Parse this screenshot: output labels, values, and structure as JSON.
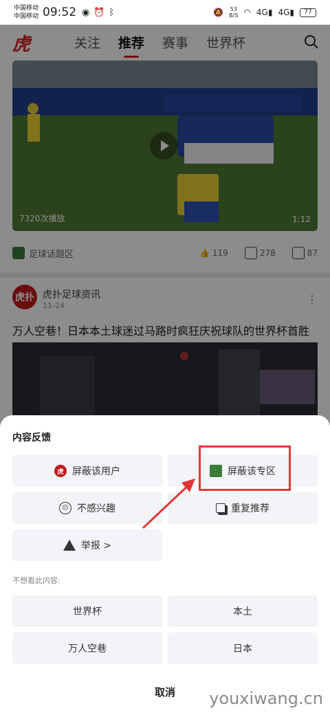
{
  "status": {
    "carriers": [
      "中国移动",
      "中国移动"
    ],
    "time": "09:52",
    "net_speed": "53\nB/S",
    "signal_labels": [
      "4G",
      "4G"
    ],
    "battery": "77"
  },
  "header": {
    "logo": "虎扑",
    "tabs": [
      {
        "label": "关注",
        "active": false
      },
      {
        "label": "推荐",
        "active": true
      },
      {
        "label": "赛事",
        "active": false
      },
      {
        "label": "世界杯",
        "active": false
      }
    ],
    "search_icon": "search-icon"
  },
  "feed": {
    "video": {
      "views": "7320次播放",
      "duration": "1:12"
    },
    "zone": "足球话题区",
    "stats": {
      "likes": "119",
      "comments": "278",
      "shares": "87"
    },
    "post": {
      "avatar": "虎扑",
      "author": "虎扑足球资讯",
      "date": "11-24",
      "title": "万人空巷！日本本土球迷过马路时疯狂庆祝球队的世界杯首胜"
    }
  },
  "sheet": {
    "title": "内容反馈",
    "options": {
      "block_user": "屏蔽该用户",
      "block_zone": "屏蔽该专区",
      "not_interested": "不感兴趣",
      "duplicate": "重复推荐",
      "report": "举报 >"
    },
    "keywords_label": "不想看此内容:",
    "keywords": [
      "世界杯",
      "本土",
      "万人空巷",
      "日本"
    ],
    "cancel": "取消"
  },
  "watermark": "youxiwang.cn",
  "colors": {
    "accent": "#d81e1e",
    "highlight": "#e23636",
    "option_bg": "#f2f4f7"
  }
}
